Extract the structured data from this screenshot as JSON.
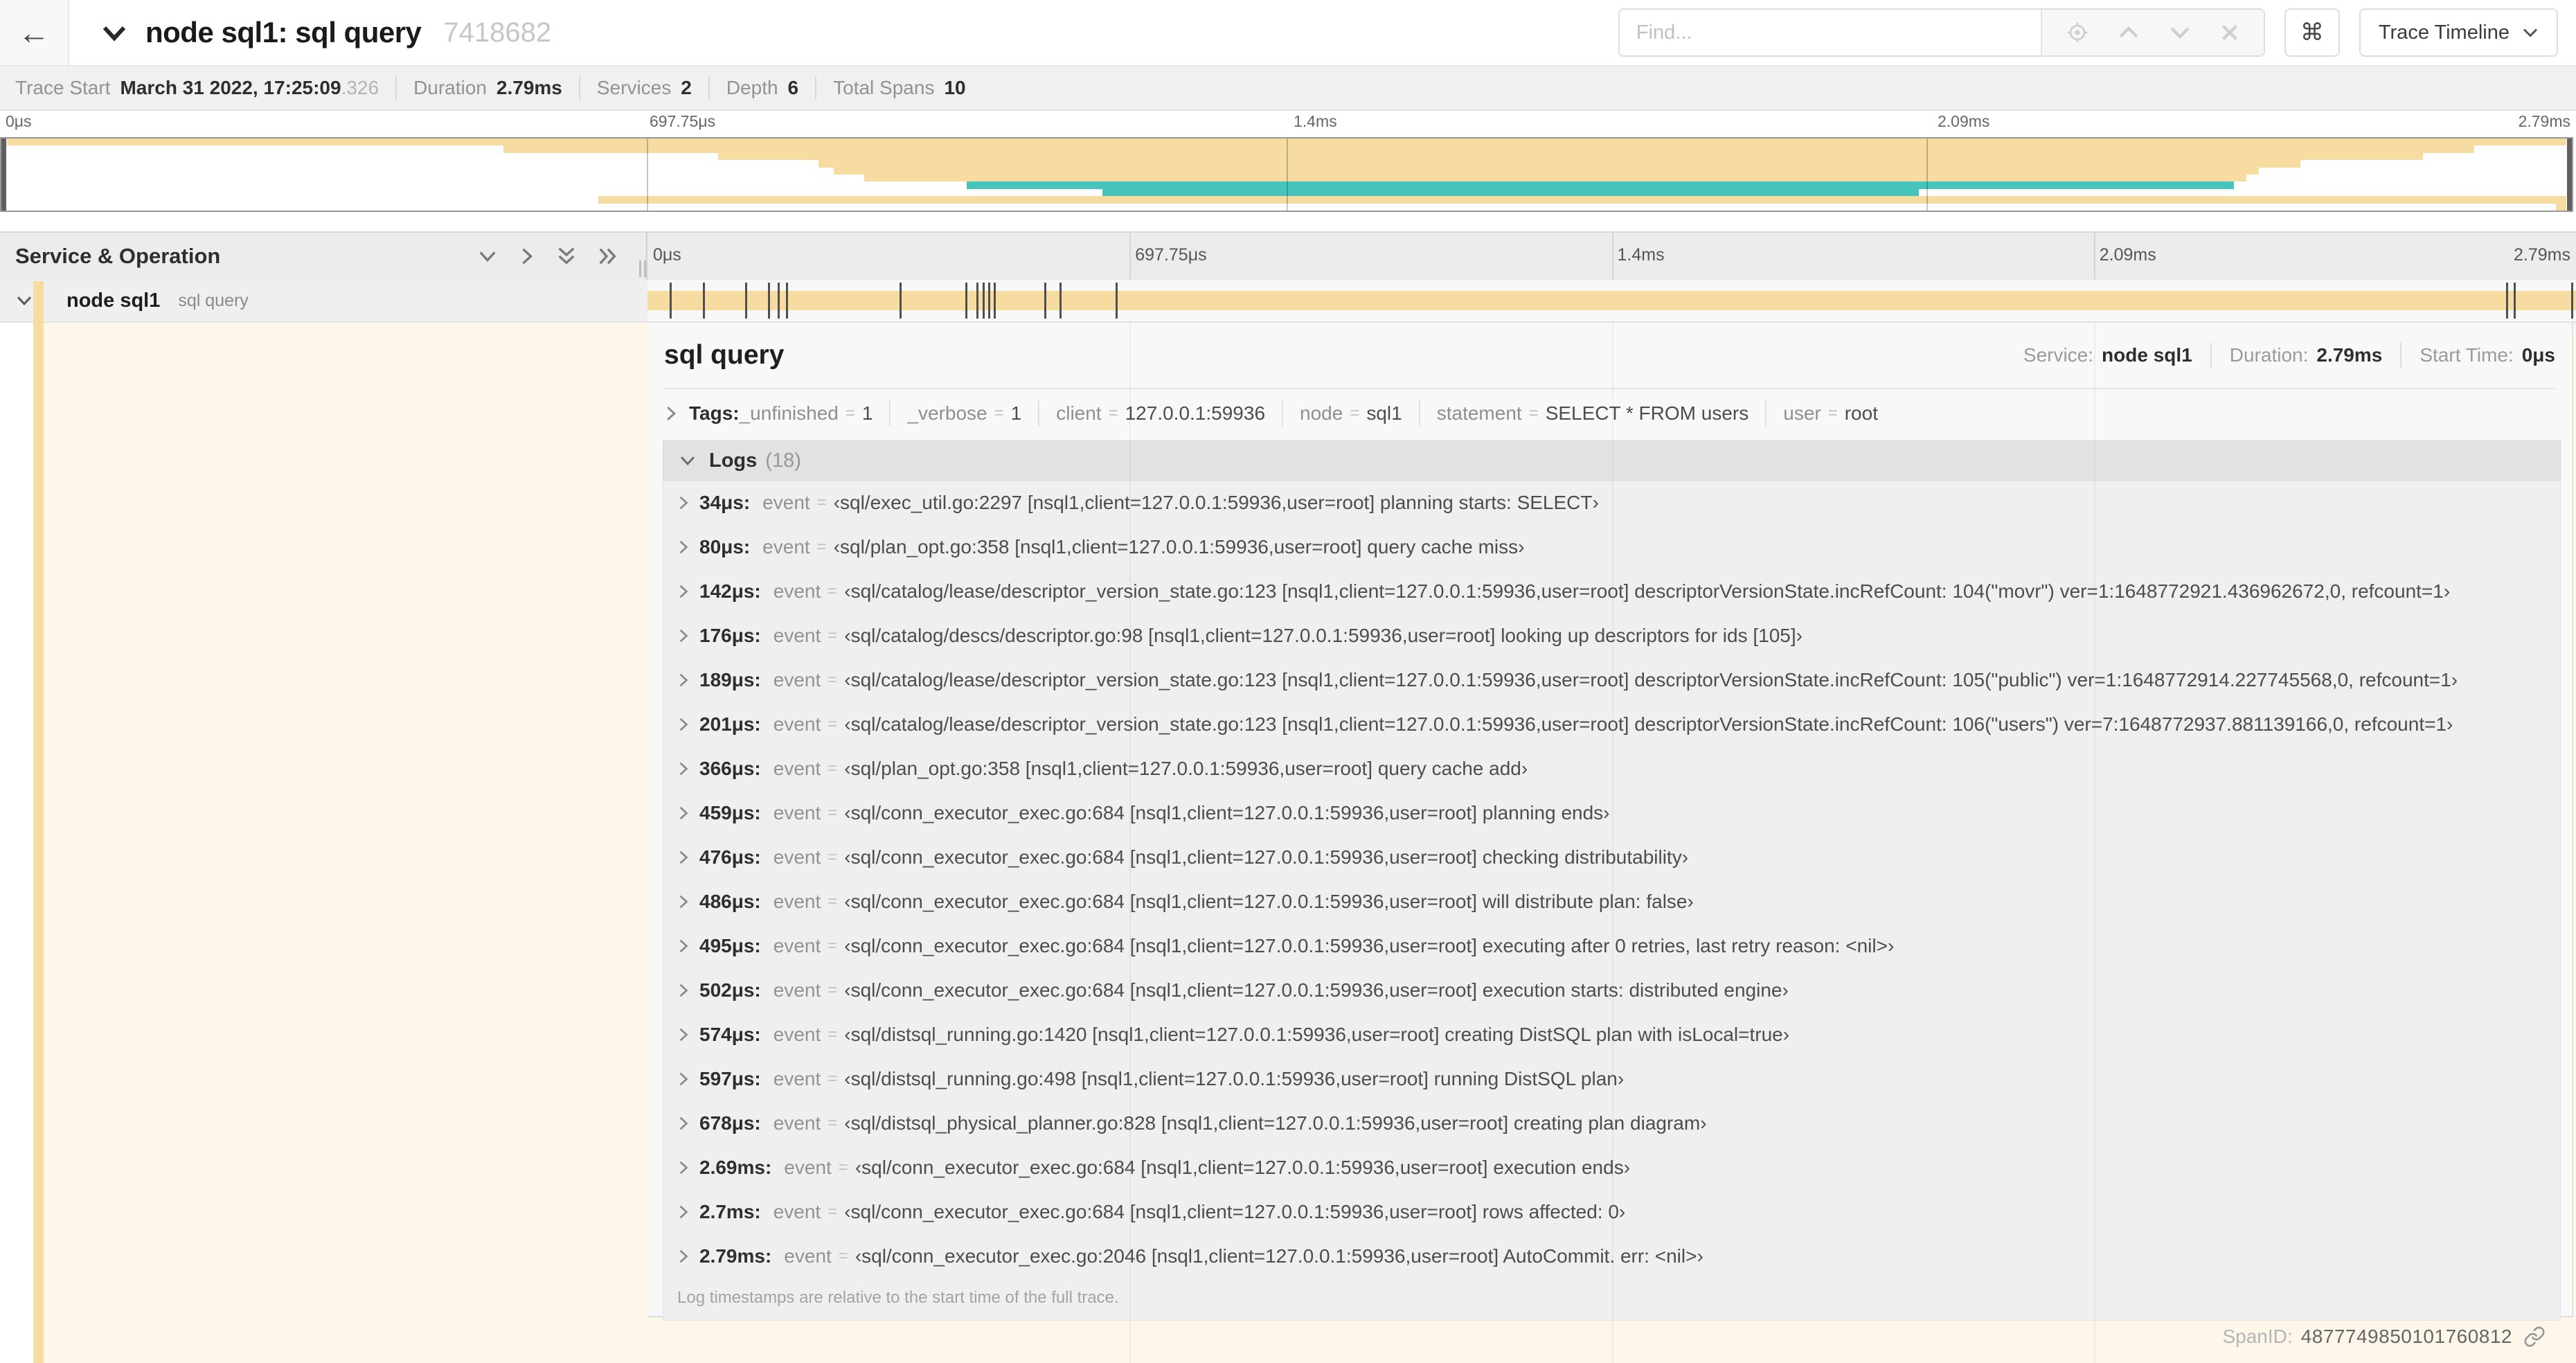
{
  "header": {
    "back_icon": "←",
    "title": "node sql1: sql query",
    "trace_id": "7418682",
    "find_placeholder": "Find...",
    "shortcut_icon": "⌘",
    "view_dropdown": "Trace Timeline"
  },
  "summary": {
    "items": [
      {
        "label": "Trace Start",
        "value": "March 31 2022, 17:25:09",
        "suffix": ".326"
      },
      {
        "label": "Duration",
        "value": "2.79ms",
        "suffix": ""
      },
      {
        "label": "Services",
        "value": "2",
        "suffix": ""
      },
      {
        "label": "Depth",
        "value": "6",
        "suffix": ""
      },
      {
        "label": "Total Spans",
        "value": "10",
        "suffix": ""
      }
    ]
  },
  "timeline": {
    "ticks": [
      {
        "pct": 0,
        "label": "0μs"
      },
      {
        "pct": 25,
        "label": "697.75μs"
      },
      {
        "pct": 50,
        "label": "1.4ms"
      },
      {
        "pct": 75,
        "label": "2.09ms"
      },
      {
        "pct": 100,
        "label": "2.79ms"
      }
    ],
    "gridline_pcts": [
      25,
      50,
      75
    ],
    "minimap_spans": [
      {
        "start": 0,
        "width": 100,
        "color": "beige"
      },
      {
        "start": 19.4,
        "width": 77.0,
        "color": "beige"
      },
      {
        "start": 27.8,
        "width": 66.6,
        "color": "beige"
      },
      {
        "start": 31.7,
        "width": 57.9,
        "color": "beige"
      },
      {
        "start": 32.3,
        "width": 55.7,
        "color": "beige"
      },
      {
        "start": 33.5,
        "width": 54.0,
        "color": "beige"
      },
      {
        "start": 37.5,
        "width": 49.5,
        "color": "teal"
      },
      {
        "start": 42.8,
        "width": 31.9,
        "color": "teal"
      },
      {
        "start": 23.1,
        "width": 76.9,
        "color": "beige"
      },
      {
        "start": 99.6,
        "width": 0.4,
        "color": "beige"
      }
    ]
  },
  "grid_header": {
    "title": "Service & Operation"
  },
  "span_row": {
    "service": "node sql1",
    "operation": "sql query",
    "marker_pcts": [
      1.2,
      2.9,
      5.1,
      6.3,
      6.8,
      7.2,
      13.1,
      16.5,
      17.1,
      17.4,
      17.7,
      18.0,
      20.6,
      21.4,
      24.3,
      96.4,
      96.8,
      99.8
    ]
  },
  "detail": {
    "title": "sql query",
    "stats": [
      {
        "label": "Service:",
        "value": "node sql1"
      },
      {
        "label": "Duration:",
        "value": "2.79ms"
      },
      {
        "label": "Start Time:",
        "value": "0μs"
      }
    ],
    "tags_label": "Tags:",
    "eq_sign": "=",
    "tags": [
      {
        "key": "_unfinished",
        "value": "1"
      },
      {
        "key": "_verbose",
        "value": "1"
      },
      {
        "key": "client",
        "value": "127.0.0.1:59936"
      },
      {
        "key": "node",
        "value": "sql1"
      },
      {
        "key": "statement",
        "value": "SELECT * FROM users"
      },
      {
        "key": "user",
        "value": "root"
      }
    ],
    "logs_label": "Logs",
    "logs_count": "(18)",
    "logs": [
      {
        "time": "34μs:",
        "field": "event",
        "value": "‹sql/exec_util.go:2297 [nsql1,client=127.0.0.1:59936,user=root] planning starts: SELECT›"
      },
      {
        "time": "80μs:",
        "field": "event",
        "value": "‹sql/plan_opt.go:358 [nsql1,client=127.0.0.1:59936,user=root] query cache miss›"
      },
      {
        "time": "142μs:",
        "field": "event",
        "value": "‹sql/catalog/lease/descriptor_version_state.go:123 [nsql1,client=127.0.0.1:59936,user=root] descriptorVersionState.incRefCount: 104(\"movr\") ver=1:1648772921.436962672,0, refcount=1›"
      },
      {
        "time": "176μs:",
        "field": "event",
        "value": "‹sql/catalog/descs/descriptor.go:98 [nsql1,client=127.0.0.1:59936,user=root] looking up descriptors for ids [105]›"
      },
      {
        "time": "189μs:",
        "field": "event",
        "value": "‹sql/catalog/lease/descriptor_version_state.go:123 [nsql1,client=127.0.0.1:59936,user=root] descriptorVersionState.incRefCount: 105(\"public\") ver=1:1648772914.227745568,0, refcount=1›"
      },
      {
        "time": "201μs:",
        "field": "event",
        "value": "‹sql/catalog/lease/descriptor_version_state.go:123 [nsql1,client=127.0.0.1:59936,user=root] descriptorVersionState.incRefCount: 106(\"users\") ver=7:1648772937.881139166,0, refcount=1›"
      },
      {
        "time": "366μs:",
        "field": "event",
        "value": "‹sql/plan_opt.go:358 [nsql1,client=127.0.0.1:59936,user=root] query cache add›"
      },
      {
        "time": "459μs:",
        "field": "event",
        "value": "‹sql/conn_executor_exec.go:684 [nsql1,client=127.0.0.1:59936,user=root] planning ends›"
      },
      {
        "time": "476μs:",
        "field": "event",
        "value": "‹sql/conn_executor_exec.go:684 [nsql1,client=127.0.0.1:59936,user=root] checking distributability›"
      },
      {
        "time": "486μs:",
        "field": "event",
        "value": "‹sql/conn_executor_exec.go:684 [nsql1,client=127.0.0.1:59936,user=root] will distribute plan: false›"
      },
      {
        "time": "495μs:",
        "field": "event",
        "value": "‹sql/conn_executor_exec.go:684 [nsql1,client=127.0.0.1:59936,user=root] executing after 0 retries, last retry reason: <nil>›"
      },
      {
        "time": "502μs:",
        "field": "event",
        "value": "‹sql/conn_executor_exec.go:684 [nsql1,client=127.0.0.1:59936,user=root] execution starts: distributed engine›"
      },
      {
        "time": "574μs:",
        "field": "event",
        "value": "‹sql/distsql_running.go:1420 [nsql1,client=127.0.0.1:59936,user=root] creating DistSQL plan with isLocal=true›"
      },
      {
        "time": "597μs:",
        "field": "event",
        "value": "‹sql/distsql_running.go:498 [nsql1,client=127.0.0.1:59936,user=root] running DistSQL plan›"
      },
      {
        "time": "678μs:",
        "field": "event",
        "value": "‹sql/distsql_physical_planner.go:828 [nsql1,client=127.0.0.1:59936,user=root] creating plan diagram›"
      },
      {
        "time": "2.69ms:",
        "field": "event",
        "value": "‹sql/conn_executor_exec.go:684 [nsql1,client=127.0.0.1:59936,user=root] execution ends›"
      },
      {
        "time": "2.7ms:",
        "field": "event",
        "value": "‹sql/conn_executor_exec.go:684 [nsql1,client=127.0.0.1:59936,user=root] rows affected: 0›"
      },
      {
        "time": "2.79ms:",
        "field": "event",
        "value": "‹sql/conn_executor_exec.go:2046 [nsql1,client=127.0.0.1:59936,user=root] AutoCommit. err: <nil>›"
      }
    ],
    "logs_note": "Log timestamps are relative to the start time of the full trace.",
    "span_id_label": "SpanID:",
    "span_id": "4877749850101760812"
  },
  "colors": {
    "beige": "#F7DCA2",
    "teal": "#46C5BD",
    "cream": "#FDF6E9"
  }
}
